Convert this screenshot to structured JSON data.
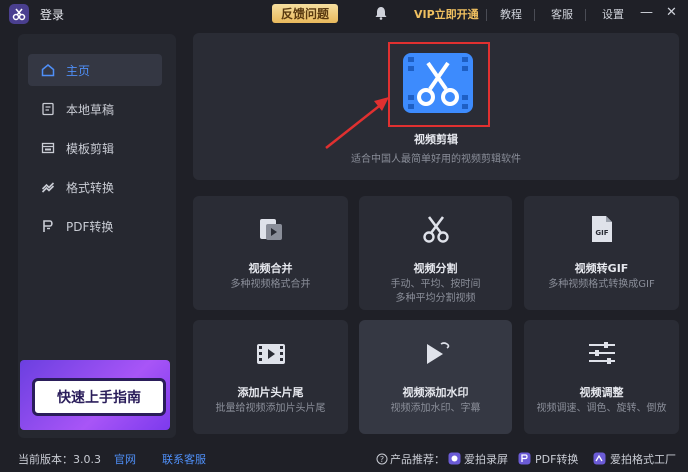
{
  "titlebar": {
    "login": "登录",
    "feedback": "反馈问题",
    "vip": "VIP立即开通",
    "tutorial": "教程",
    "support": "客服",
    "settings": "设置",
    "minimize": "—",
    "close": "✕"
  },
  "sidebar": {
    "items": [
      {
        "label": "主页",
        "icon": "home-icon"
      },
      {
        "label": "本地草稿",
        "icon": "draft-icon"
      },
      {
        "label": "模板剪辑",
        "icon": "template-icon"
      },
      {
        "label": "格式转换",
        "icon": "convert-icon"
      },
      {
        "label": "PDF转换",
        "icon": "pdf-icon"
      }
    ],
    "banner": "快速上手指南"
  },
  "main": {
    "title": "视频剪辑",
    "desc": "适合中国人最简单好用的视频剪辑软件"
  },
  "tools": [
    {
      "title": "视频合并",
      "desc1": "多种视频格式合并",
      "desc2": ""
    },
    {
      "title": "视频分割",
      "desc1": "手动、平均、按时间",
      "desc2": "多种平均分割视频"
    },
    {
      "title": "视频转GIF",
      "desc1": "多种视频格式转换成GIF",
      "desc2": ""
    },
    {
      "title": "添加片头片尾",
      "desc1": "批量给视频添加片头片尾",
      "desc2": ""
    },
    {
      "title": "视频添加水印",
      "desc1": "视频添加水印、字幕",
      "desc2": ""
    },
    {
      "title": "视频调整",
      "desc1": "视频调速、调色、旋转、倒放",
      "desc2": ""
    }
  ],
  "gif_icon_text": "GIF",
  "status": {
    "version_label": "当前版本：3.0.3",
    "website": "官网",
    "contact": "联系客服",
    "recommend": "产品推荐：",
    "p1": "爱拍录屏",
    "p2": "PDF转换",
    "p3": "爱拍格式工厂"
  },
  "colors": {
    "accent": "#4f8ff7",
    "vip": "#f0c060",
    "highlight": "#e03030"
  }
}
